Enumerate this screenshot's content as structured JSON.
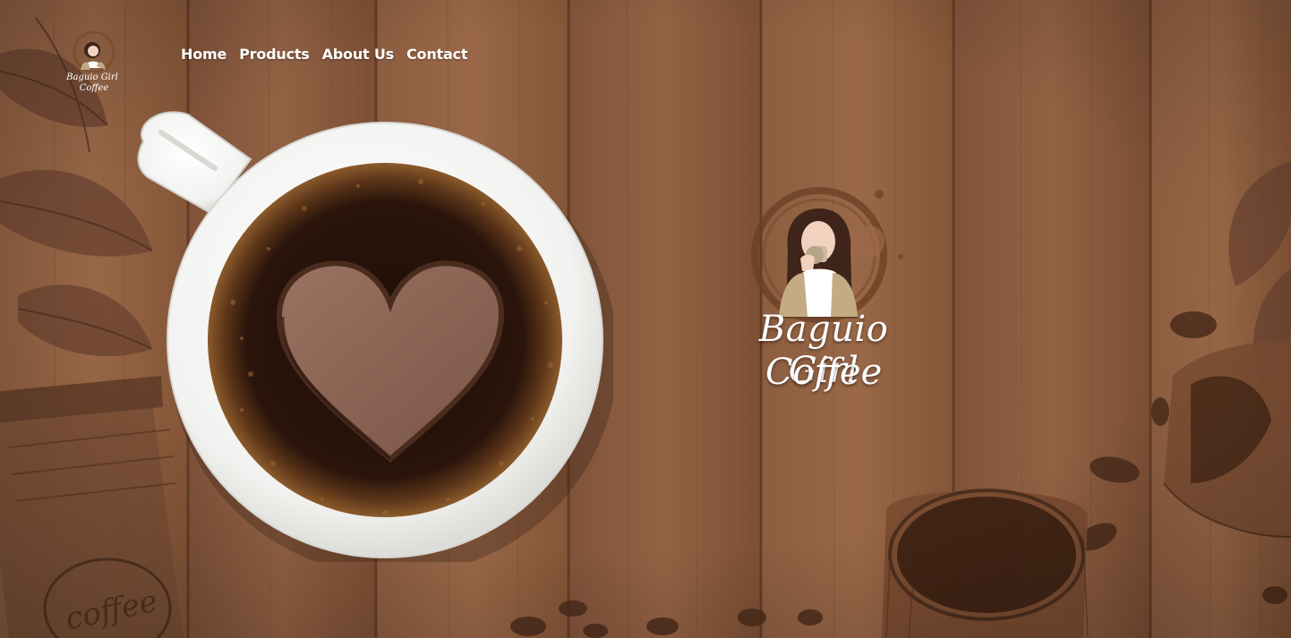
{
  "site": {
    "logo_icon": "baguio-girl-coffee-logo",
    "logo_text_line1": "Baguio Girl",
    "logo_text_line2": "Coffee"
  },
  "nav": {
    "items": [
      {
        "label": "Home"
      },
      {
        "label": "Products"
      },
      {
        "label": "About Us"
      },
      {
        "label": "Contact"
      }
    ]
  },
  "hero": {
    "cup_icon": "coffee-cup-heart-illustration",
    "emblem_icon": "girl-drinking-coffee-emblem",
    "brand_line1": "Baguio Girl",
    "brand_line2": "Coffee"
  },
  "colors": {
    "wood": "#8a5a3c",
    "wood_dark": "#5e3a24",
    "coffee": "#2a140b",
    "heart": "#8c6453",
    "cup": "#f4f4f2",
    "text": "#ffffff"
  }
}
